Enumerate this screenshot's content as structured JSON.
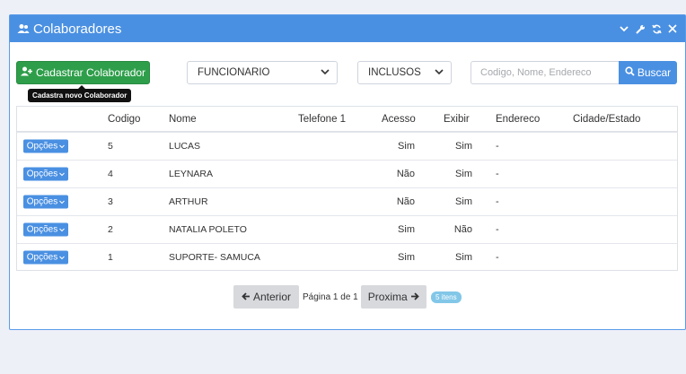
{
  "panel": {
    "title": "Colaboradores",
    "title_icon": "users-icon",
    "tools": [
      "chevron-down-icon",
      "wrench-icon",
      "refresh-icon",
      "close-icon"
    ]
  },
  "toolbar": {
    "add_label": "Cadastrar Colaborador",
    "add_icon": "user-plus-icon",
    "tooltip": "Cadastra novo Colaborador",
    "type_select": "FUNCIONARIO",
    "include_select": "INCLUSOS",
    "search_placeholder": "Codigo, Nome, Endereco",
    "search_label": "Buscar"
  },
  "table": {
    "headers": {
      "codigo": "Codigo",
      "nome": "Nome",
      "telefone": "Telefone 1",
      "acesso": "Acesso",
      "exibir": "Exibir",
      "endereco": "Endereco",
      "cidade": "Cidade/Estado"
    },
    "options_label": "Opções",
    "rows": [
      {
        "codigo": "5",
        "nome": "LUCAS",
        "telefone": "",
        "acesso": "Sim",
        "exibir": "Sim",
        "endereco": "-",
        "cidade": ""
      },
      {
        "codigo": "4",
        "nome": "LEYNARA",
        "telefone": "",
        "acesso": "Não",
        "exibir": "Sim",
        "endereco": "-",
        "cidade": ""
      },
      {
        "codigo": "3",
        "nome": "ARTHUR",
        "telefone": "",
        "acesso": "Não",
        "exibir": "Sim",
        "endereco": "-",
        "cidade": ""
      },
      {
        "codigo": "2",
        "nome": "NATALIA POLETO",
        "telefone": "",
        "acesso": "Sim",
        "exibir": "Não",
        "endereco": "-",
        "cidade": ""
      },
      {
        "codigo": "1",
        "nome": "SUPORTE- SAMUCA",
        "telefone": "",
        "acesso": "Sim",
        "exibir": "Sim",
        "endereco": "-",
        "cidade": ""
      }
    ]
  },
  "pagination": {
    "prev_label": "Anterior",
    "page_text": "Página 1 de 1",
    "next_label": "Proxima",
    "count_badge": "5 itens"
  }
}
